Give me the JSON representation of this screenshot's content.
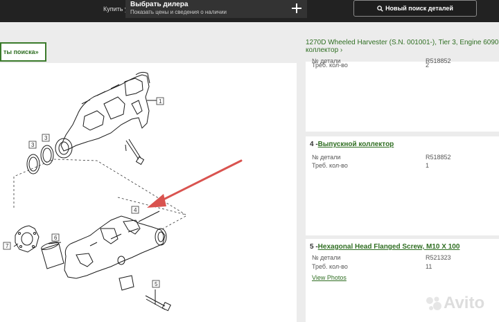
{
  "header": {
    "buy_label": "Купить у",
    "dealer_title": "Выбрать дилера",
    "dealer_subtitle": "Показать цены и сведения о наличии",
    "search_button": "Новый поиск деталей"
  },
  "results_button": "ты поиска»",
  "breadcrumb": {
    "line1": "1270D Wheeled Harvester (S.N. 001001-), Tier 3, Engine 6090",
    "line2": "коллектор ›"
  },
  "part_top": {
    "qty_label": "Треб. кол-во",
    "qty_value": "2",
    "partial_label": "№ детали",
    "partial_value": "R518852"
  },
  "part_4": {
    "number": "4 -",
    "name": "Выпускной коллектор",
    "part_no_label": "№ детали",
    "part_no_value": "R518852",
    "qty_label": "Треб. кол-во",
    "qty_value": "1"
  },
  "part_5": {
    "number": "5 -",
    "name": "Hexagonal Head Flanged Screw, M10 X 100",
    "part_no_label": "№ детали",
    "part_no_value": "R521323",
    "qty_label": "Треб. кол-во",
    "qty_value": "11",
    "view_photos": "View Photos"
  },
  "diagram": {
    "callouts": [
      "1",
      "3",
      "3",
      "4",
      "5",
      "6",
      "7"
    ]
  },
  "watermark": "Avito",
  "colors": {
    "green": "#2f6e22",
    "topbar": "#222222",
    "arrow": "#d9534f"
  }
}
